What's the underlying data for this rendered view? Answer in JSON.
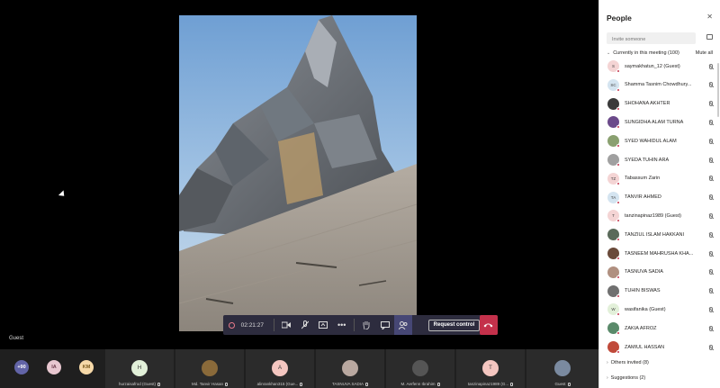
{
  "stage": {
    "guest_tag": "Guest"
  },
  "controls": {
    "timer": "02:21:27",
    "request_control": "Request control",
    "icons": [
      "record-icon",
      "video-icon",
      "mic-icon",
      "share-icon",
      "more-icon",
      "raise-hand-icon",
      "chat-icon",
      "people-icon",
      "hangup-icon"
    ]
  },
  "strip": {
    "bubbles": [
      {
        "label": "+90",
        "bg": "#6264a7",
        "fg": "#ffffff"
      },
      {
        "label": "IA",
        "bg": "#e8c7d0",
        "fg": "#6b3a4a"
      },
      {
        "label": "KM",
        "bg": "#f6d9a8",
        "fg": "#7a5a1e"
      }
    ],
    "tiles": [
      {
        "name": "hurzaisafrod (Guest)",
        "initials": "H",
        "bg": "#e2f0d9"
      },
      {
        "name": "Md. Tanvir Hasan",
        "initials": "",
        "bg": "#8a6a3a"
      },
      {
        "name": "alinrankhan315 (Gue...",
        "initials": "A",
        "bg": "#f4c6c0"
      },
      {
        "name": "TASNUVA SADIA",
        "initials": "",
        "bg": "#b9a8a0"
      },
      {
        "name": "M. Aerfenn Ibrahim",
        "initials": "",
        "bg": "#555555"
      },
      {
        "name": "tanzinapinaz1989 (G...",
        "initials": "T",
        "bg": "#f4c6c0"
      },
      {
        "name": "Guest",
        "initials": "",
        "bg": "#7a8aa0"
      }
    ]
  },
  "panel": {
    "title": "People",
    "invite_placeholder": "Invite someone",
    "section": "Currently in this meeting (100)",
    "mute_all": "Mute all",
    "others": "Others invited (8)",
    "suggestions": "Suggestions (2)",
    "people": [
      {
        "name": "saymakhatun_12 (Guest)",
        "initials": "S",
        "bg": "#f4d4d4"
      },
      {
        "name": "Shamma Tasnim Chowdhury...",
        "initials": "SC",
        "bg": "#d4e4f0"
      },
      {
        "name": "SHOHANA AKHTER",
        "initials": "",
        "bg": "#3a3a3a"
      },
      {
        "name": "SUNGIDHA ALAM TURNA",
        "initials": "",
        "bg": "#6b4a8a"
      },
      {
        "name": "SYED WAHIDUL ALAM",
        "initials": "",
        "bg": "#8aa070"
      },
      {
        "name": "SYEDA TUHIN ARA",
        "initials": "",
        "bg": "#a0a0a0"
      },
      {
        "name": "Tabassum Zarin",
        "initials": "TZ",
        "bg": "#f4d4d4"
      },
      {
        "name": "TANVIR AHMED",
        "initials": "TA",
        "bg": "#d4e4f0"
      },
      {
        "name": "tanzinapinaz1989 (Guest)",
        "initials": "T",
        "bg": "#f4d4d4"
      },
      {
        "name": "TANZIUL ISLAM HAKKANI",
        "initials": "",
        "bg": "#5a6a5a"
      },
      {
        "name": "TASNEEM MAHRUSHA KHA...",
        "initials": "",
        "bg": "#6a4a3a"
      },
      {
        "name": "TASNUVA SADIA",
        "initials": "",
        "bg": "#b09080"
      },
      {
        "name": "TUHIN BISWAS",
        "initials": "",
        "bg": "#707070"
      },
      {
        "name": "wasifanika (Guest)",
        "initials": "W",
        "bg": "#e2f0d9"
      },
      {
        "name": "ZAKIA AFROZ",
        "initials": "",
        "bg": "#5a8a6a"
      },
      {
        "name": "ZAMIUL HASSAN",
        "initials": "",
        "bg": "#c04a3a"
      }
    ]
  }
}
